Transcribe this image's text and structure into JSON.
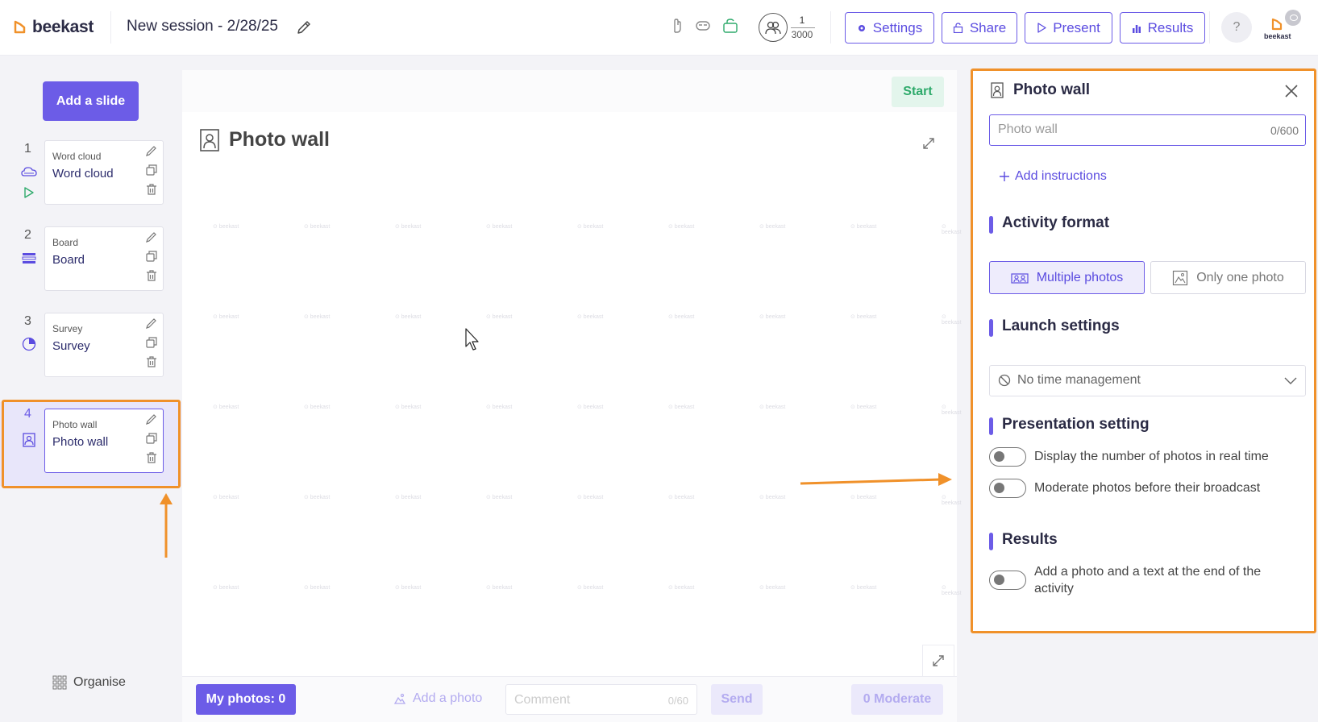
{
  "header": {
    "logo_text": "beekast",
    "session_title": "New session - 2/28/25",
    "participants_current": "1",
    "participants_total": "3000",
    "buttons": {
      "settings": "Settings",
      "share": "Share",
      "present": "Present",
      "results": "Results"
    },
    "help": "?",
    "avatar_label": "beekast",
    "icons": [
      "hand-icon",
      "mask-icon",
      "lock-icon",
      "participants-icon"
    ]
  },
  "sidebar": {
    "add_slide": "Add a slide",
    "slides": [
      {
        "num": "1",
        "kind": "Word cloud",
        "name": "Word cloud",
        "icon": "cloud-icon",
        "played": true
      },
      {
        "num": "2",
        "kind": "Board",
        "name": "Board",
        "icon": "board-icon"
      },
      {
        "num": "3",
        "kind": "Survey",
        "name": "Survey",
        "icon": "pie-icon"
      },
      {
        "num": "4",
        "kind": "Photo wall",
        "name": "Photo wall",
        "icon": "photo-icon",
        "active": true
      }
    ],
    "organise": "Organise"
  },
  "canvas": {
    "start": "Start",
    "title": "Photo wall",
    "watermark": "beekast",
    "bottom": {
      "my_photos": "My photos: 0",
      "add_photo": "Add a photo",
      "comment_placeholder": "Comment",
      "comment_count": "0/60",
      "send": "Send",
      "moderate": "0 Moderate"
    }
  },
  "panel": {
    "title": "Photo wall",
    "title_input_placeholder": "Photo wall",
    "title_input_count": "0/600",
    "add_instructions": "Add instructions",
    "activity_format": {
      "heading": "Activity format",
      "options": [
        "Multiple photos",
        "Only one photo"
      ],
      "selected": "Multiple photos"
    },
    "launch_settings": {
      "heading": "Launch settings",
      "time_value": "No time management"
    },
    "presentation": {
      "heading": "Presentation setting",
      "toggles": [
        {
          "label": "Display the number of photos in real time",
          "on": false
        },
        {
          "label": "Moderate photos before their broadcast",
          "on": false
        }
      ]
    },
    "results": {
      "heading": "Results",
      "toggle_label_line1": "Add a photo and a text at the end of the",
      "toggle_label_line2": "activity",
      "on": false
    }
  },
  "colors": {
    "accent": "#6c5ce7",
    "annotation": "#f0912a",
    "start_green": "#2eaa6b"
  }
}
